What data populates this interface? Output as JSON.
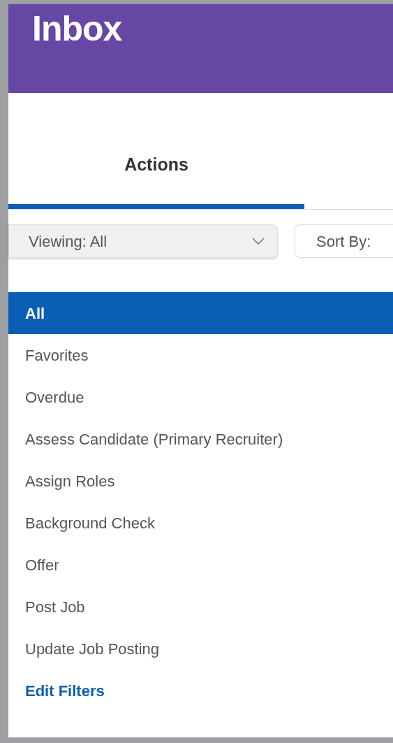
{
  "header": {
    "title": "Inbox"
  },
  "tabs": [
    {
      "label": "Actions",
      "selected": true
    }
  ],
  "viewing": {
    "label": "Viewing:",
    "value": "All",
    "expanded": true
  },
  "sort": {
    "label": "Sort By:"
  },
  "filter_options": [
    {
      "label": "All",
      "selected": true
    },
    {
      "label": "Favorites",
      "selected": false
    },
    {
      "label": "Overdue",
      "selected": false
    },
    {
      "label": "Assess Candidate (Primary Recruiter)",
      "selected": false
    },
    {
      "label": "Assign Roles",
      "selected": false
    },
    {
      "label": "Background Check",
      "selected": false
    },
    {
      "label": "Offer",
      "selected": false
    },
    {
      "label": "Post Job",
      "selected": false
    },
    {
      "label": "Update Job Posting",
      "selected": false
    }
  ],
  "edit_link": "Edit Filters"
}
